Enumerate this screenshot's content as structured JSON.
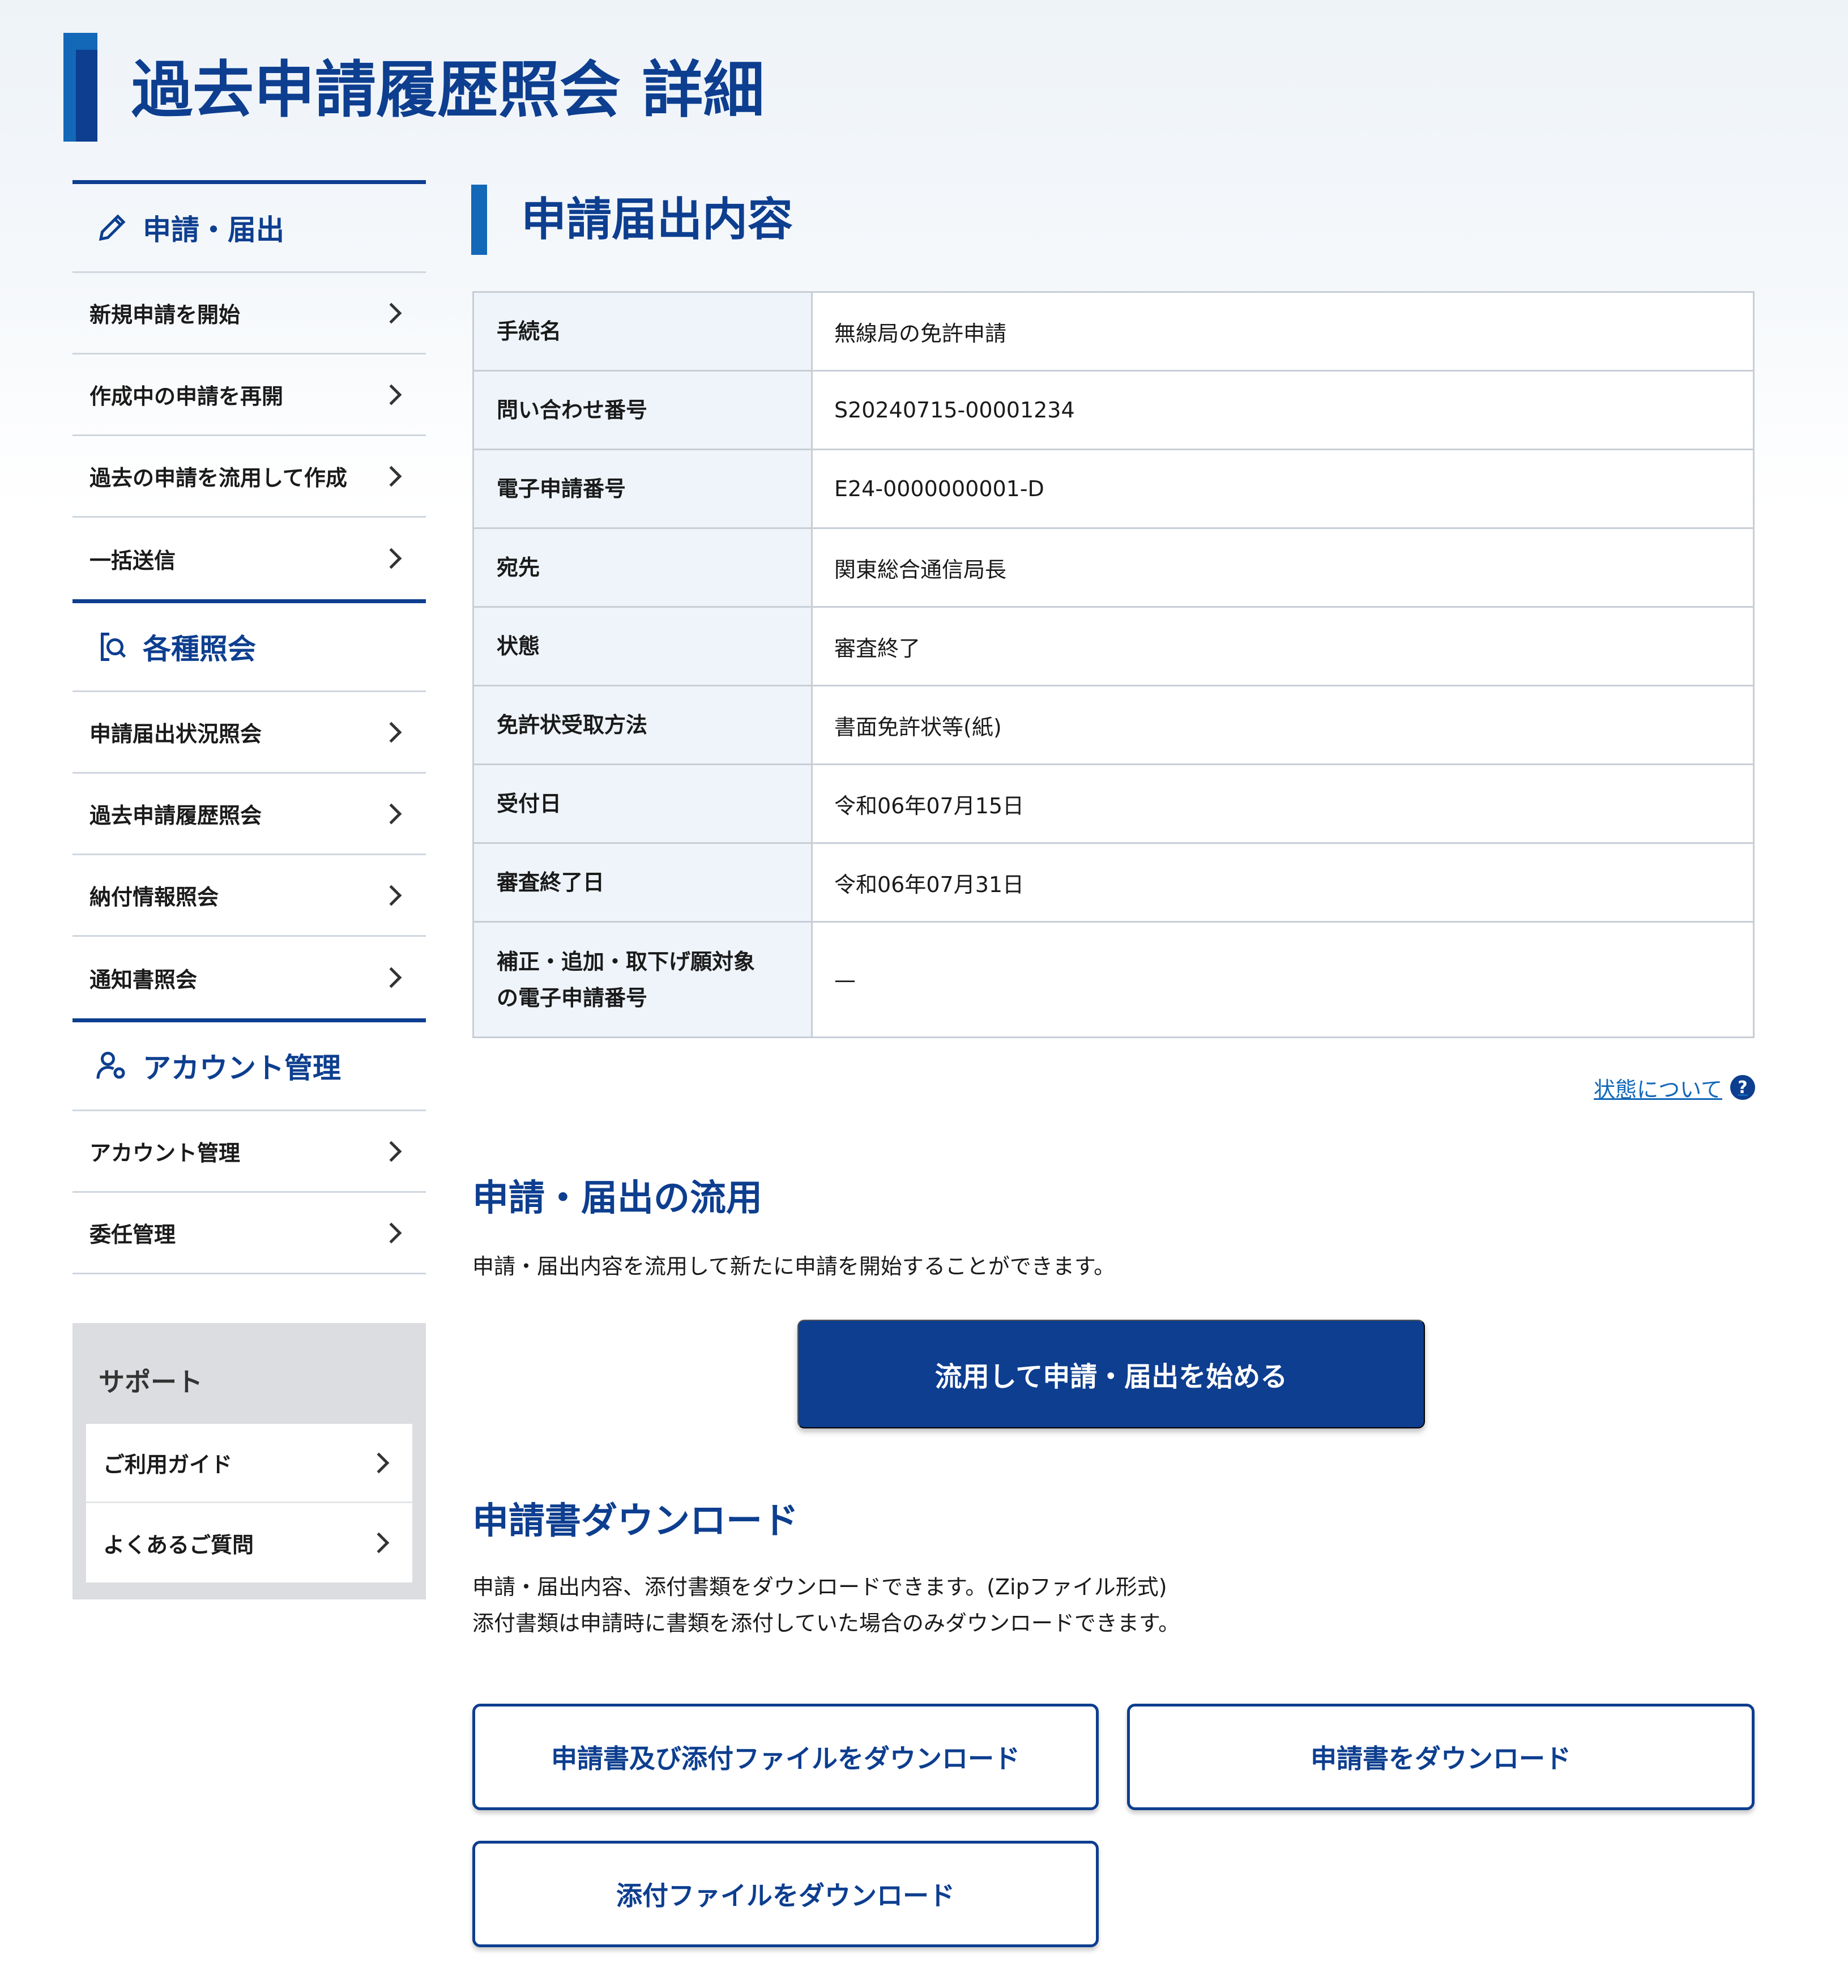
{
  "page": {
    "title": "過去申請履歴照会 詳細"
  },
  "sidebar": {
    "sections": [
      {
        "heading": "申請・届出",
        "icon": "pencil-icon",
        "items": [
          {
            "label": "新規申請を開始"
          },
          {
            "label": "作成中の申請を再開"
          },
          {
            "label": "過去の申請を流用して作成"
          },
          {
            "label": "一括送信"
          }
        ]
      },
      {
        "heading": "各種照会",
        "icon": "search-document-icon",
        "items": [
          {
            "label": "申請届出状況照会"
          },
          {
            "label": "過去申請履歴照会"
          },
          {
            "label": "納付情報照会"
          },
          {
            "label": "通知書照会"
          }
        ]
      },
      {
        "heading": "アカウント管理",
        "icon": "user-gear-icon",
        "items": [
          {
            "label": "アカウント管理"
          },
          {
            "label": "委任管理"
          }
        ]
      }
    ],
    "support": {
      "title": "サポート",
      "items": [
        {
          "label": "ご利用ガイド"
        },
        {
          "label": "よくあるご質問"
        }
      ]
    }
  },
  "main": {
    "section_title": "申請届出内容",
    "table": [
      {
        "key": "手続名",
        "value": "無線局の免許申請"
      },
      {
        "key": "問い合わせ番号",
        "value": "S20240715-00001234"
      },
      {
        "key": "電子申請番号",
        "value": "E24-0000000001-D"
      },
      {
        "key": "宛先",
        "value": "関東総合通信局長"
      },
      {
        "key": "状態",
        "value": "審査終了"
      },
      {
        "key": "免許状受取方法",
        "value": "書面免許状等(紙)"
      },
      {
        "key": "受付日",
        "value": "令和06年07月15日"
      },
      {
        "key": "審査終了日",
        "value": "令和06年07月31日"
      },
      {
        "key_line1": "補正・追加・取下げ願対象",
        "key_line2": "の電子申請番号",
        "value": "—"
      }
    ],
    "status_link": "状態について",
    "reuse": {
      "heading": "申請・届出の流用",
      "description": "申請・届出内容を流用して新たに申請を開始することができます。",
      "button": "流用して申請・届出を始める"
    },
    "download": {
      "heading": "申請書ダウンロード",
      "description_line1": "申請・届出内容、添付書類をダウンロードできます。(Zipファイル形式)",
      "description_line2": "添付書類は申請時に書類を添付していた場合のみダウンロードできます。",
      "buttons": {
        "all": "申請書及び添付ファイルをダウンロード",
        "application": "申請書をダウンロード",
        "attachments": "添付ファイルをダウンロード"
      }
    }
  },
  "colors": {
    "primary": "#0d3e8f",
    "accent": "#1368b8",
    "table_key_bg": "#eef4fa",
    "border": "#c8ced6"
  }
}
